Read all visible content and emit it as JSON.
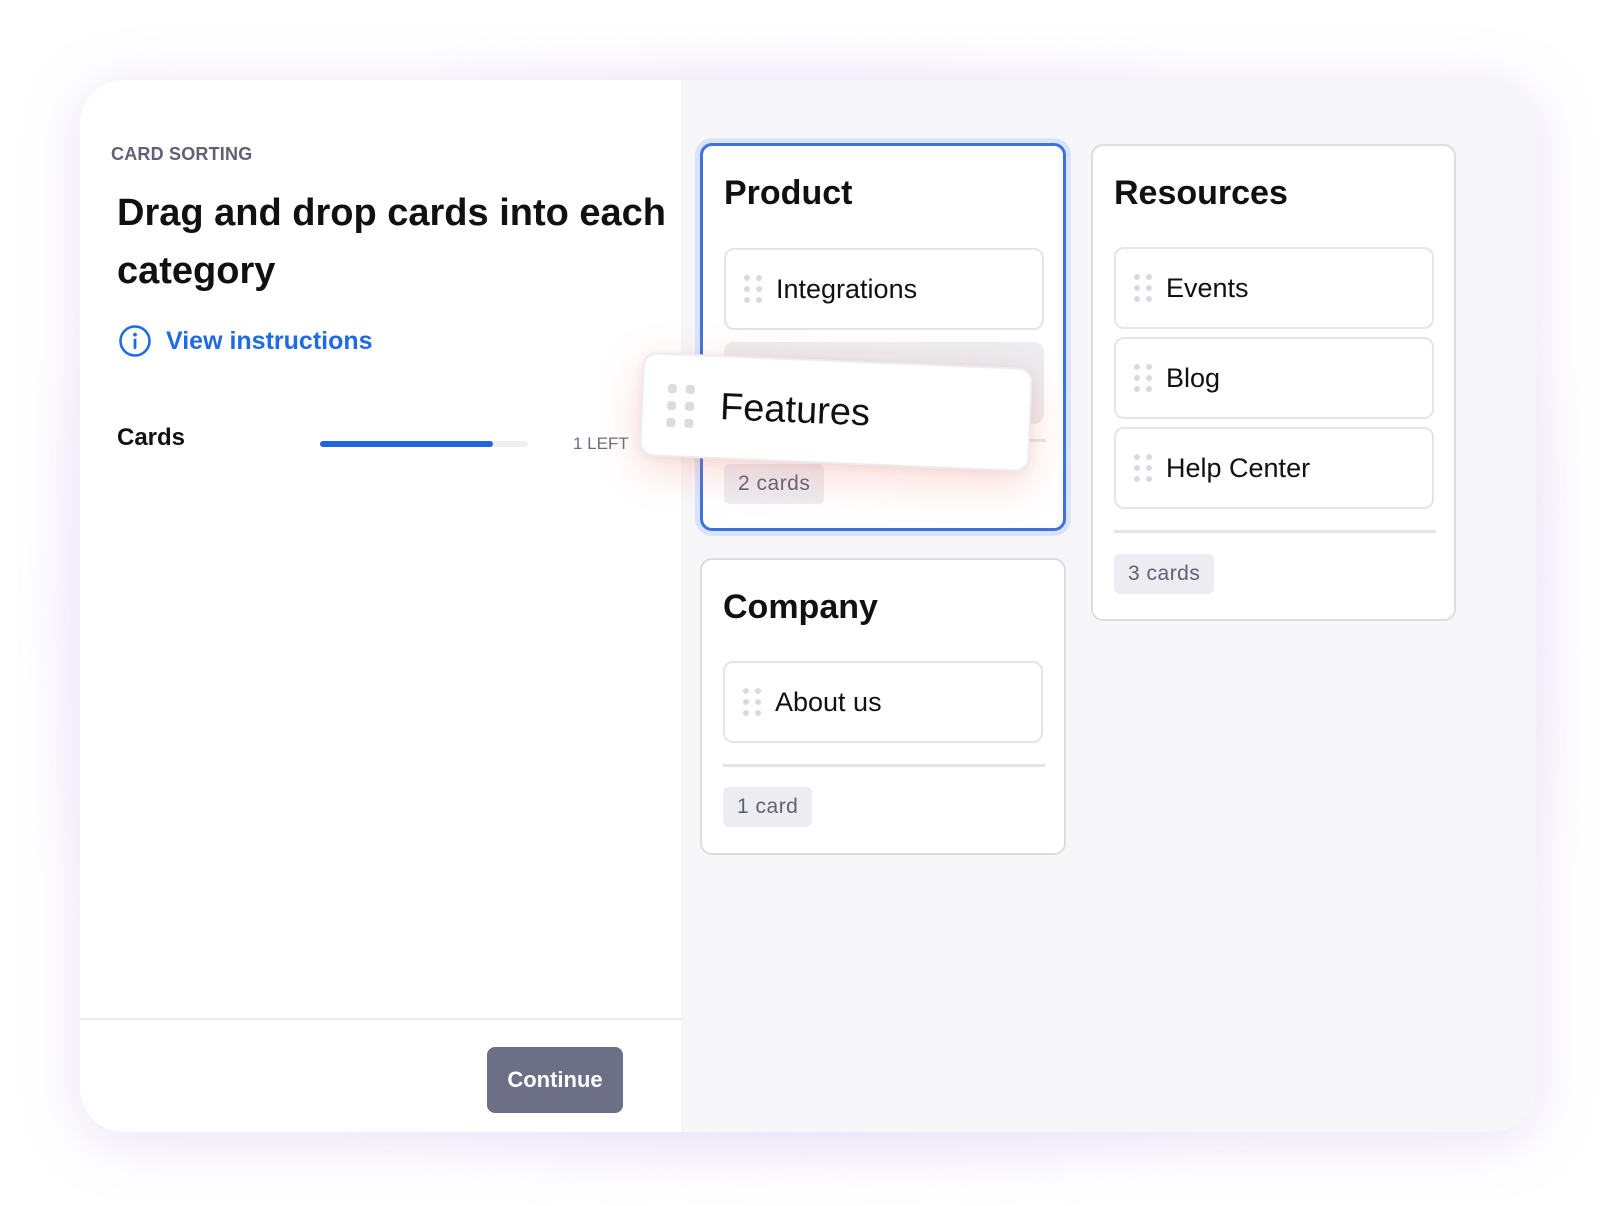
{
  "task": {
    "eyebrow": "CARD SORTING",
    "title": "Drag and drop cards into each category",
    "instructions_link": "View instructions"
  },
  "progress": {
    "label": "Cards",
    "remaining_text": "1 LEFT",
    "fraction_complete": 0.83
  },
  "footer": {
    "continue_label": "Continue"
  },
  "categories": [
    {
      "title": "Product",
      "cards": [
        "Integrations"
      ],
      "count_label": "2 cards",
      "highlighted": true
    },
    {
      "title": "Resources",
      "cards": [
        "Events",
        "Blog",
        "Help Center"
      ],
      "count_label": "3 cards"
    },
    {
      "title": "Company",
      "cards": [
        "About us"
      ],
      "count_label": "1 card"
    }
  ],
  "dragging_card": {
    "label": "Features"
  },
  "icons": {
    "info": "info-circle-icon",
    "grip": "drag-handle-icon"
  },
  "colors": {
    "accent": "#1f63e0",
    "button": "#6c6f86",
    "active_border": "#3d72e0"
  }
}
